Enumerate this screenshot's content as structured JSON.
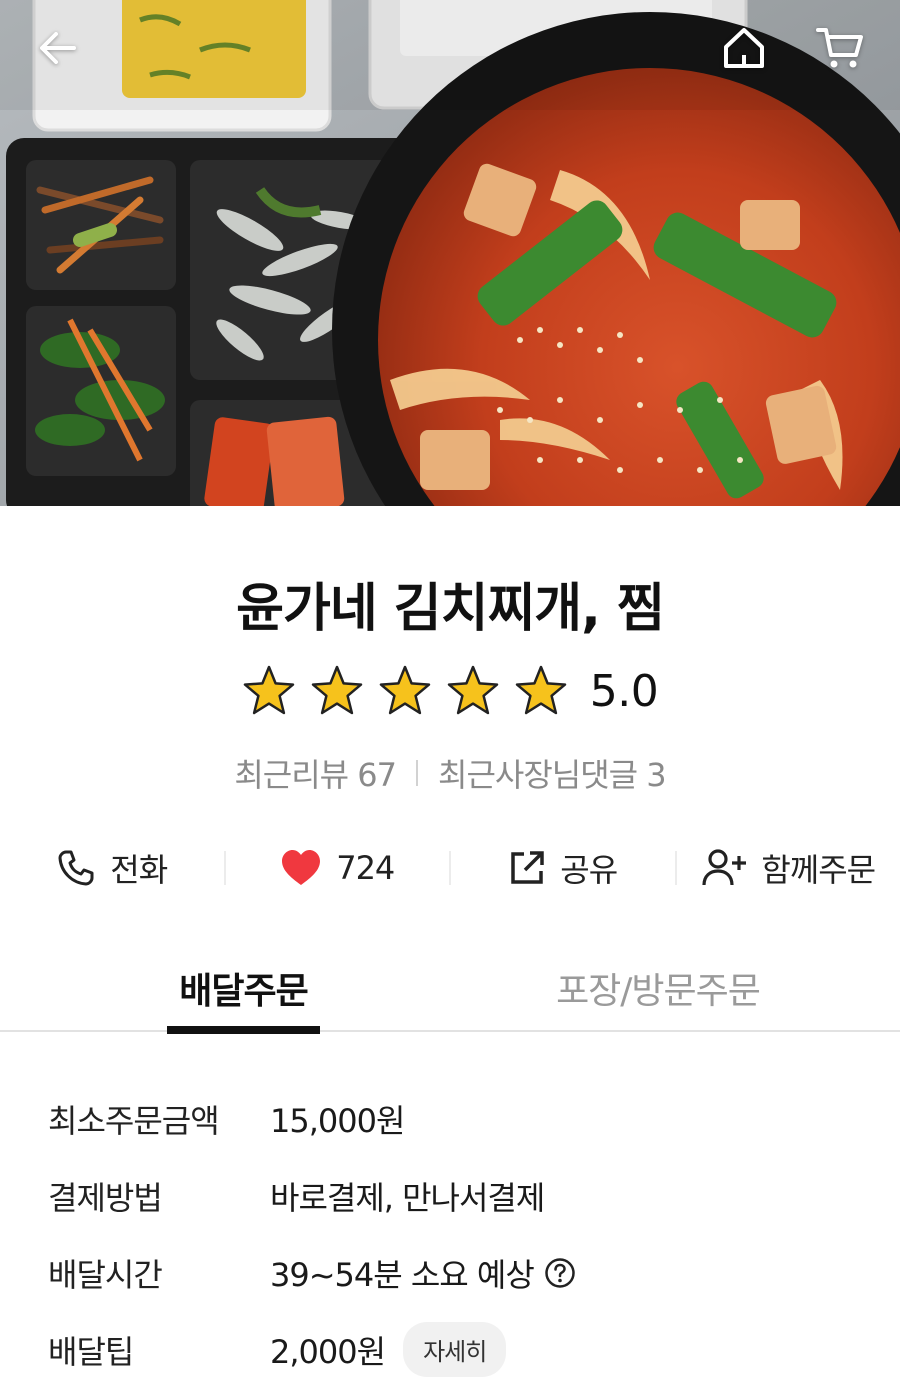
{
  "header": {
    "back_icon": "arrow-left-icon",
    "home_icon": "home-icon",
    "cart_icon": "cart-icon"
  },
  "store": {
    "name": "윤가네 김치찌개, 찜",
    "rating": 5.0,
    "rating_label": "5.0",
    "recent_reviews": "최근리뷰 67",
    "owner_replies": "최근사장님댓글 3"
  },
  "actions": {
    "call_label": "전화",
    "like_count": "724",
    "share_label": "공유",
    "group_order_label": "함께주문"
  },
  "tabs": [
    {
      "label": "배달주문",
      "active": true
    },
    {
      "label": "포장/방문주문",
      "active": false
    }
  ],
  "info": {
    "min_order_label": "최소주문금액",
    "min_order_value": "15,000원",
    "payment_label": "결제방법",
    "payment_value": "바로결제, 만나서결제",
    "delivery_time_label": "배달시간",
    "delivery_time_value": "39~54분 소요 예상",
    "delivery_tip_label": "배달팁",
    "delivery_tip_value": "2,000원",
    "detail_label": "자세히"
  },
  "colors": {
    "star": "#f6c21c",
    "heart": "#f0383f",
    "text": "#111111",
    "muted": "#8a8a8a"
  }
}
